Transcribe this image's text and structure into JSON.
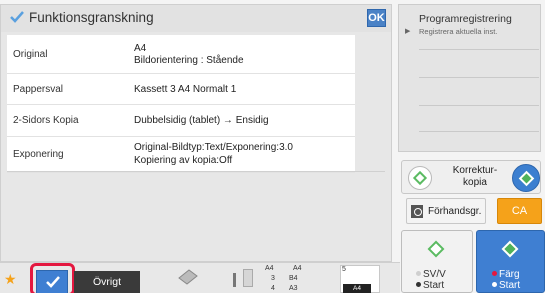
{
  "review": {
    "title": "Funktionsgranskning",
    "ok_label": "OK",
    "rows": [
      {
        "label": "Original",
        "value_line1": "A4",
        "value_line2": "Bildorientering : Stående"
      },
      {
        "label": "Pappersval",
        "value_line1": "Kassett 3  A4  Normalt 1"
      },
      {
        "label": "2-Sidors Kopia",
        "value_line1": "Dubbelsidig (tablet) → Ensidig"
      },
      {
        "label": "Exponering",
        "value_line1": "Original-Bildtyp:Text/Exponering:3.0",
        "value_line2": "Kopiering av kopia:Off"
      }
    ]
  },
  "program": {
    "title": "Programregistrering",
    "subtitle": "Registrera aktuella inst."
  },
  "controls": {
    "correction_line1": "Korrektur-",
    "correction_line2": "kopia",
    "preview_label": "Förhandsgr.",
    "ca_label": "CA",
    "start_bw_line1": "SV/V",
    "start_bw_line2": "Start",
    "start_color_line1": "Färg",
    "start_color_line2": "Start"
  },
  "bottom": {
    "other_label": "Övrigt",
    "tray_labels": [
      "A4",
      "A4",
      "3",
      "B4",
      "4",
      "A3"
    ],
    "paper_count": "5",
    "paper_size": "A4"
  },
  "icons": {
    "star": "star-icon",
    "check": "checkmark-icon",
    "preview": "preview-icon"
  },
  "colors": {
    "accent_blue": "#3f7fd2",
    "ca_orange": "#f5a21a",
    "highlight_red": "#e4173f",
    "start_green": "#5bbb62"
  }
}
